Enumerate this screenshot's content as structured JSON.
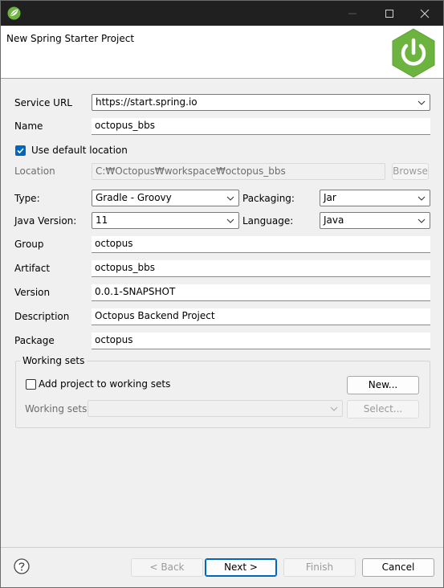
{
  "window": {
    "title": "New Spring Starter Project"
  },
  "form": {
    "service_url": {
      "label": "Service URL",
      "value": "https://start.spring.io"
    },
    "name": {
      "label": "Name",
      "value": "octopus_bbs"
    },
    "use_default_location": {
      "label": "Use default location",
      "checked": true
    },
    "location": {
      "label": "Location",
      "value": "C:₩Octopus₩workspace₩octopus_bbs",
      "browse": "Browse"
    },
    "type": {
      "label": "Type:",
      "value": "Gradle - Groovy"
    },
    "packaging": {
      "label": "Packaging:",
      "value": "Jar"
    },
    "java_version": {
      "label": "Java Version:",
      "value": "11"
    },
    "language": {
      "label": "Language:",
      "value": "Java"
    },
    "group": {
      "label": "Group",
      "value": "octopus"
    },
    "artifact": {
      "label": "Artifact",
      "value": "octopus_bbs"
    },
    "version": {
      "label": "Version",
      "value": "0.0.1-SNAPSHOT"
    },
    "description": {
      "label": "Description",
      "value": "Octopus Backend Project"
    },
    "package": {
      "label": "Package",
      "value": "octopus"
    }
  },
  "working_sets": {
    "title": "Working sets",
    "add_label": "Add project to working sets",
    "add_checked": false,
    "new_button": "New...",
    "sets_label": "Working sets:",
    "select_button": "Select..."
  },
  "footer": {
    "back": "< Back",
    "next": "Next >",
    "finish": "Finish",
    "cancel": "Cancel"
  },
  "colors": {
    "accent": "#0067c0",
    "spring_green": "#6db33f",
    "titlebar": "#202020"
  },
  "icons": [
    "spring-app-icon",
    "minimize-icon",
    "maximize-icon",
    "close-icon",
    "spring-power-logo",
    "chevron-down-icon",
    "help-icon"
  ]
}
